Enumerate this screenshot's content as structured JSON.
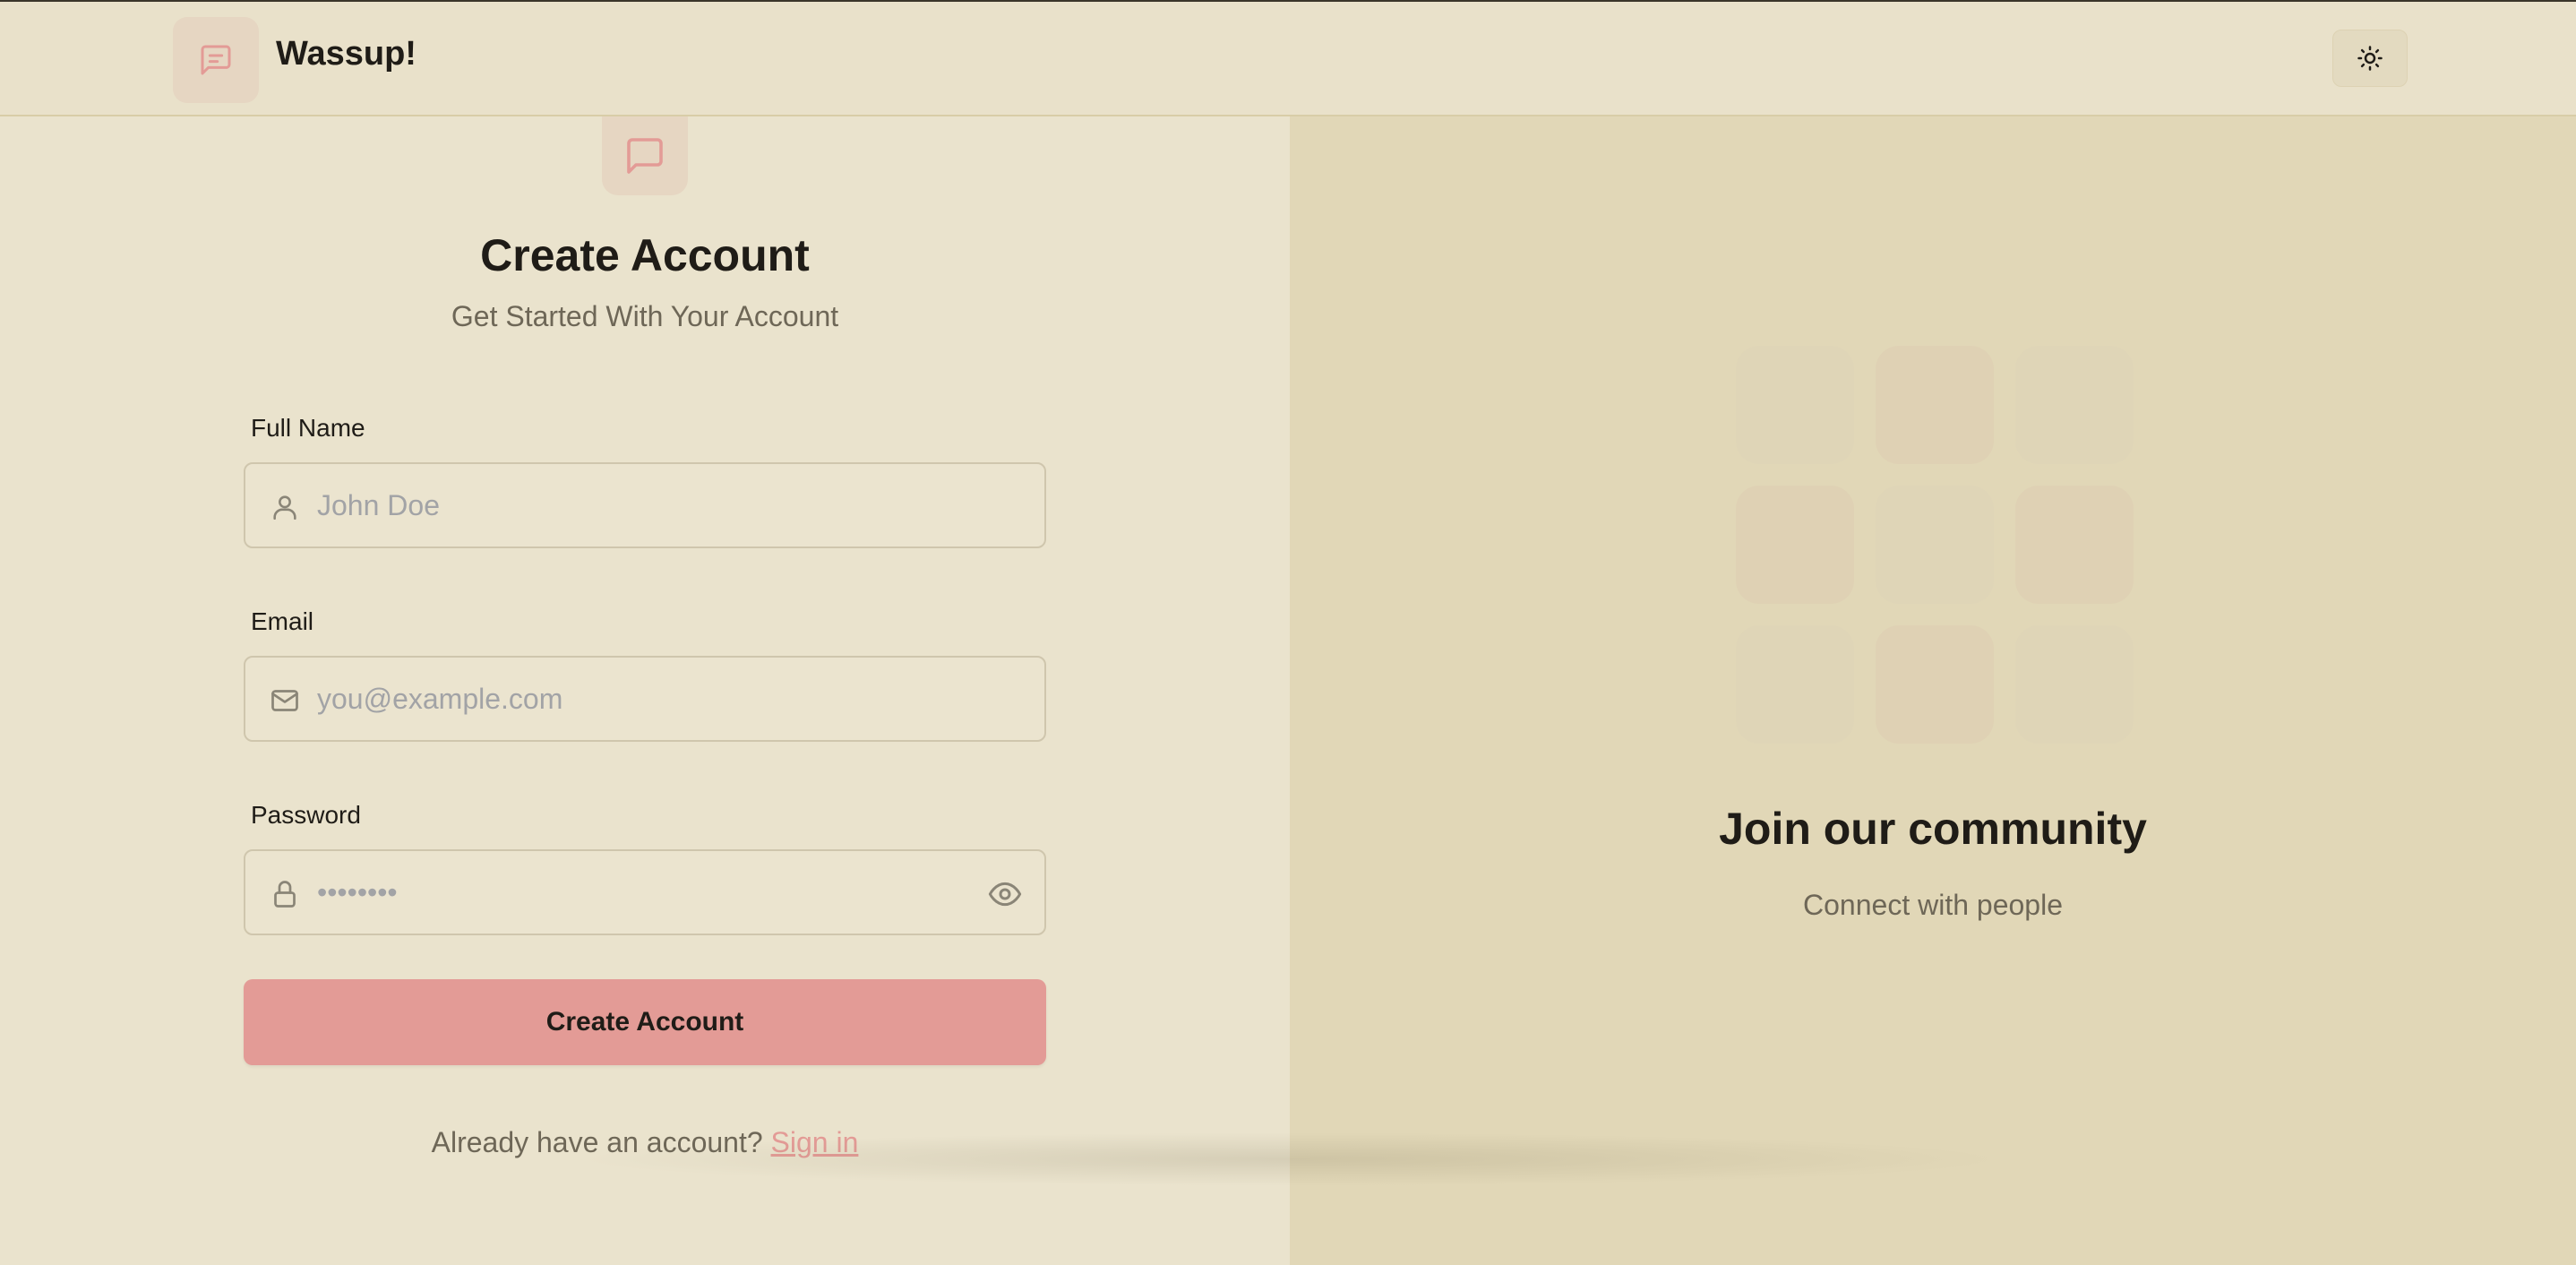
{
  "header": {
    "brand_name": "Wassup!",
    "brand_icon": "message-square-icon",
    "theme_toggle_icon": "sun-icon"
  },
  "form": {
    "logo_icon": "message-square-icon",
    "title": "Create Account",
    "subtitle": "Get Started With Your Account",
    "full_name": {
      "label": "Full Name",
      "placeholder": "John Doe",
      "value": "",
      "icon": "user-icon"
    },
    "email": {
      "label": "Email",
      "placeholder": "you@example.com",
      "value": "",
      "icon": "mail-icon"
    },
    "password": {
      "label": "Password",
      "placeholder": "••••••••",
      "value": "",
      "icon": "lock-icon",
      "toggle_icon": "eye-icon"
    },
    "submit_label": "Create Account",
    "signin_prompt": "Already have an account?",
    "signin_link": "Sign in"
  },
  "side_panel": {
    "title": "Join our community",
    "subtitle": "Connect with people"
  },
  "colors": {
    "accent": "#e39b96",
    "background": "#eae3cd",
    "side_panel": "#e1d7b7"
  }
}
